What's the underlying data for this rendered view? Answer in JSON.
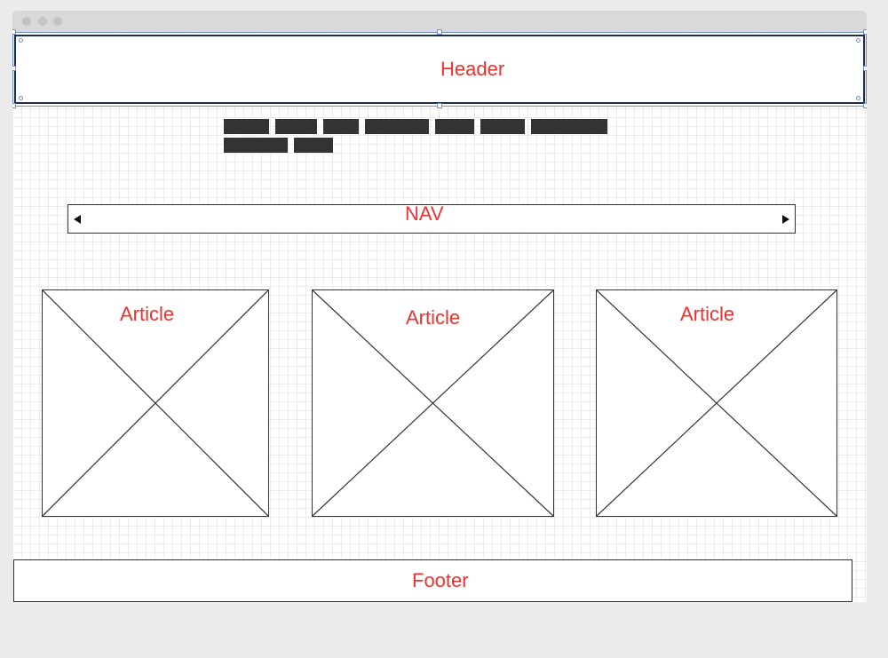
{
  "window": {
    "controls": [
      "close-dot",
      "minimize-dot",
      "maximize-dot"
    ]
  },
  "header": {
    "label": "Header"
  },
  "nav": {
    "label": "NAV"
  },
  "articles": [
    {
      "label": "Article"
    },
    {
      "label": "Article"
    },
    {
      "label": "Article"
    }
  ],
  "footer": {
    "label": "Footer"
  },
  "colors": {
    "label_red": "#f0312e",
    "selection_blue": "#6d8fd6",
    "placeholder_dark": "#333333"
  }
}
